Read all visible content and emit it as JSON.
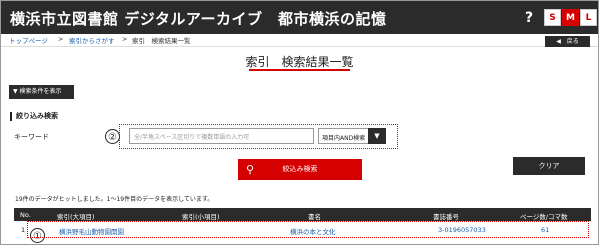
{
  "header": {
    "site_title": "横浜市立図書館 デジタルアーカイブ　都市横浜の記憶",
    "help_icon": "?",
    "font_sizes": [
      "S",
      "M",
      "L"
    ]
  },
  "breadcrumb": {
    "home": "トップページ",
    "sep1": ">",
    "parent": "索引からさがす",
    "sep2": ">",
    "current": "索引　検索結果一覧"
  },
  "back_button": "◀　戻る",
  "page_title": "索引　検索結果一覧",
  "search_toggle": "▼ 検索条件を表示",
  "refine": {
    "title": "絞り込み検索",
    "keyword_label": "キーワード",
    "keyword_placeholder": "全/半角スペース区切りで複数単語の入力可",
    "select_value": "項目内AND検索",
    "select_arrow": "▼",
    "search_button": "絞込み検索",
    "clear_button": "クリア"
  },
  "annotations": {
    "marker2": "②",
    "marker1": "①"
  },
  "results": {
    "count_text": "19件のデータがヒットしました。1～19件目のデータを表示しています。",
    "headers": [
      "No.",
      "索引(大項目)",
      "索引(小項目)",
      "書名",
      "書誌番号",
      "ページ数/コマ数"
    ],
    "rows": [
      {
        "no": "1",
        "major": "横浜野毛山動物園開園",
        "minor": "",
        "book": "横浜の本と文化",
        "biblio_no": "3-0196057033",
        "pages": "61"
      }
    ]
  },
  "colors": {
    "header_bg": "#2b2b2b",
    "accent_red": "#d50000",
    "link_blue": "#1a5fa8"
  }
}
